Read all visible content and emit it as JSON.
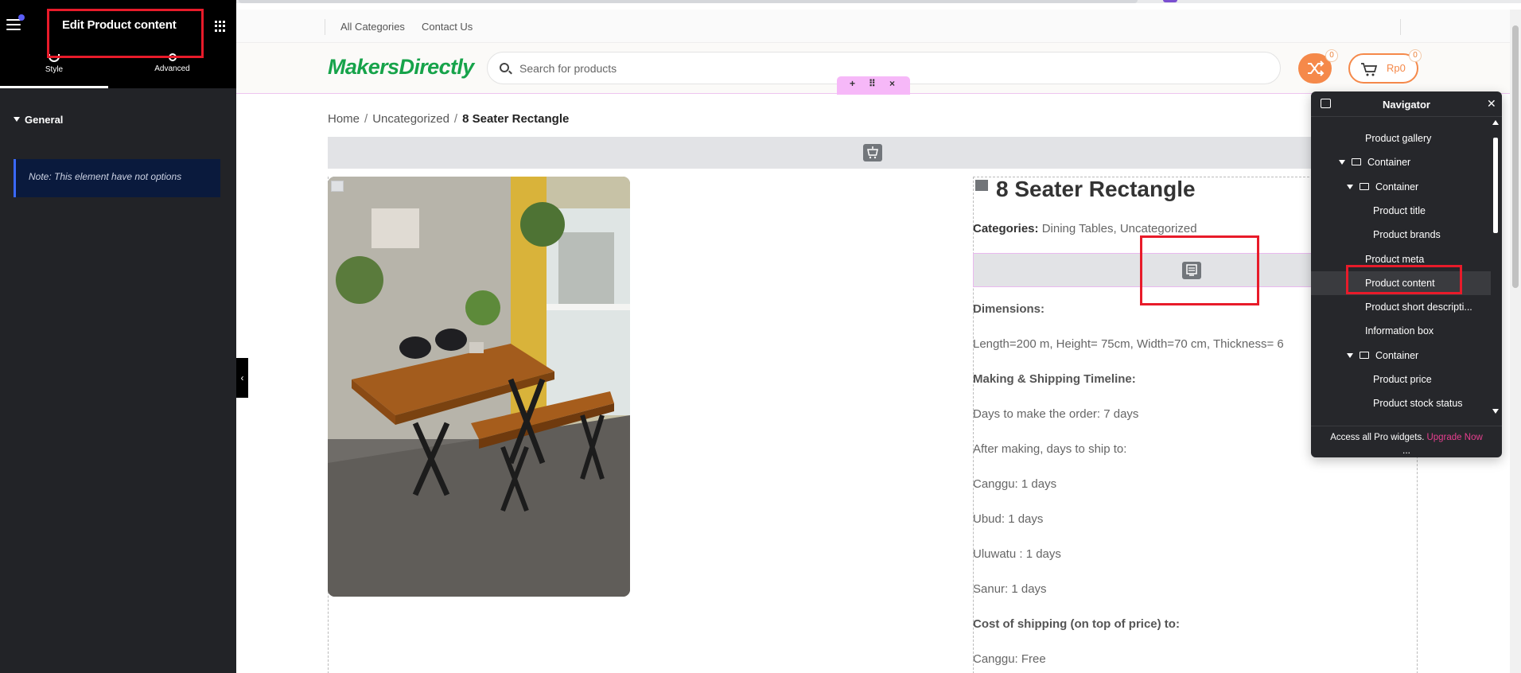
{
  "panel": {
    "title": "Edit Product content",
    "tabs": [
      {
        "label": "Style",
        "active": true
      },
      {
        "label": "Advanced",
        "active": false
      }
    ],
    "section": "General",
    "note": "Note: This element have not options"
  },
  "site": {
    "topnav": [
      "All Categories",
      "Contact Us"
    ],
    "logo": "MakersDirectly",
    "search_placeholder": "Search for products",
    "compare_count": "0",
    "cart_count": "0",
    "cart_amount": "Rp0",
    "breadcrumb": {
      "home": "Home",
      "category": "Uncategorized",
      "sep": "/",
      "current": "8 Seater Rectangle"
    }
  },
  "product": {
    "title": "8 Seater Rectangle",
    "categories_label": "Categories:",
    "categories": [
      "Dining Tables",
      "Uncategorized"
    ],
    "details": [
      {
        "text": "Dimensions:",
        "bold": true
      },
      {
        "text": "Length=200  m, Height= 75cm, Width=70 cm, Thickness= 6",
        "bold": false
      },
      {
        "text": "Making & Shipping Timeline:",
        "bold": true
      },
      {
        "text": "Days to make the order: 7 days",
        "bold": false
      },
      {
        "text": "After making, days to ship to:",
        "bold": false
      },
      {
        "text": "Canggu: 1 days",
        "bold": false
      },
      {
        "text": "Ubud: 1 days",
        "bold": false
      },
      {
        "text": "Uluwatu : 1 days",
        "bold": false
      },
      {
        "text": "Sanur: 1 days",
        "bold": false
      },
      {
        "text": "Cost of shipping (on top of price) to:",
        "bold": true
      },
      {
        "text": "Canggu:  Free",
        "bold": false
      }
    ]
  },
  "navigator": {
    "title": "Navigator",
    "items": [
      {
        "label": "Product gallery",
        "type": "widget",
        "level": 0
      },
      {
        "label": "Container",
        "type": "container",
        "level": 0
      },
      {
        "label": "Container",
        "type": "container",
        "level": 1
      },
      {
        "label": "Product title",
        "type": "widget",
        "level": 2
      },
      {
        "label": "Product brands",
        "type": "widget",
        "level": 2
      },
      {
        "label": "Product meta",
        "type": "widget",
        "level": 0
      },
      {
        "label": "Product content",
        "type": "widget",
        "level": 0,
        "selected": true
      },
      {
        "label": "Product short descripti...",
        "type": "widget",
        "level": 0
      },
      {
        "label": "Information box",
        "type": "widget",
        "level": 0
      },
      {
        "label": "Container",
        "type": "container",
        "level": 1
      },
      {
        "label": "Product price",
        "type": "widget",
        "level": 2
      },
      {
        "label": "Product stock status",
        "type": "widget",
        "level": 2
      }
    ],
    "footer_text": "Access all Pro widgets.",
    "footer_link": "Upgrade Now",
    "more": "..."
  },
  "colors": {
    "accent_orange": "#f5894a",
    "logo_green": "#16a34a",
    "highlight_red": "#e81b2a",
    "upgrade_pink": "#e63f8f"
  }
}
